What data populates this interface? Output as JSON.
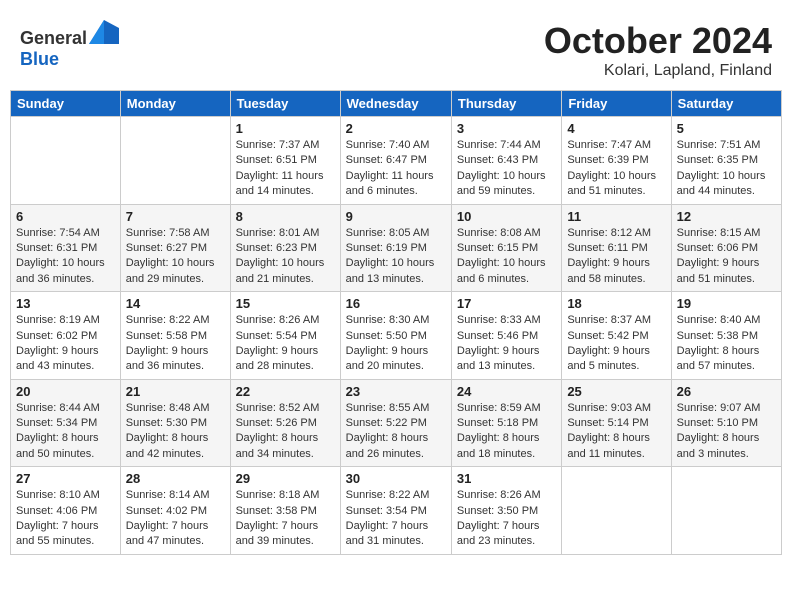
{
  "header": {
    "logo_general": "General",
    "logo_blue": "Blue",
    "month": "October 2024",
    "location": "Kolari, Lapland, Finland"
  },
  "weekdays": [
    "Sunday",
    "Monday",
    "Tuesday",
    "Wednesday",
    "Thursday",
    "Friday",
    "Saturday"
  ],
  "weeks": [
    [
      {
        "day": "",
        "detail": ""
      },
      {
        "day": "",
        "detail": ""
      },
      {
        "day": "1",
        "detail": "Sunrise: 7:37 AM\nSunset: 6:51 PM\nDaylight: 11 hours\nand 14 minutes."
      },
      {
        "day": "2",
        "detail": "Sunrise: 7:40 AM\nSunset: 6:47 PM\nDaylight: 11 hours\nand 6 minutes."
      },
      {
        "day": "3",
        "detail": "Sunrise: 7:44 AM\nSunset: 6:43 PM\nDaylight: 10 hours\nand 59 minutes."
      },
      {
        "day": "4",
        "detail": "Sunrise: 7:47 AM\nSunset: 6:39 PM\nDaylight: 10 hours\nand 51 minutes."
      },
      {
        "day": "5",
        "detail": "Sunrise: 7:51 AM\nSunset: 6:35 PM\nDaylight: 10 hours\nand 44 minutes."
      }
    ],
    [
      {
        "day": "6",
        "detail": "Sunrise: 7:54 AM\nSunset: 6:31 PM\nDaylight: 10 hours\nand 36 minutes."
      },
      {
        "day": "7",
        "detail": "Sunrise: 7:58 AM\nSunset: 6:27 PM\nDaylight: 10 hours\nand 29 minutes."
      },
      {
        "day": "8",
        "detail": "Sunrise: 8:01 AM\nSunset: 6:23 PM\nDaylight: 10 hours\nand 21 minutes."
      },
      {
        "day": "9",
        "detail": "Sunrise: 8:05 AM\nSunset: 6:19 PM\nDaylight: 10 hours\nand 13 minutes."
      },
      {
        "day": "10",
        "detail": "Sunrise: 8:08 AM\nSunset: 6:15 PM\nDaylight: 10 hours\nand 6 minutes."
      },
      {
        "day": "11",
        "detail": "Sunrise: 8:12 AM\nSunset: 6:11 PM\nDaylight: 9 hours\nand 58 minutes."
      },
      {
        "day": "12",
        "detail": "Sunrise: 8:15 AM\nSunset: 6:06 PM\nDaylight: 9 hours\nand 51 minutes."
      }
    ],
    [
      {
        "day": "13",
        "detail": "Sunrise: 8:19 AM\nSunset: 6:02 PM\nDaylight: 9 hours\nand 43 minutes."
      },
      {
        "day": "14",
        "detail": "Sunrise: 8:22 AM\nSunset: 5:58 PM\nDaylight: 9 hours\nand 36 minutes."
      },
      {
        "day": "15",
        "detail": "Sunrise: 8:26 AM\nSunset: 5:54 PM\nDaylight: 9 hours\nand 28 minutes."
      },
      {
        "day": "16",
        "detail": "Sunrise: 8:30 AM\nSunset: 5:50 PM\nDaylight: 9 hours\nand 20 minutes."
      },
      {
        "day": "17",
        "detail": "Sunrise: 8:33 AM\nSunset: 5:46 PM\nDaylight: 9 hours\nand 13 minutes."
      },
      {
        "day": "18",
        "detail": "Sunrise: 8:37 AM\nSunset: 5:42 PM\nDaylight: 9 hours\nand 5 minutes."
      },
      {
        "day": "19",
        "detail": "Sunrise: 8:40 AM\nSunset: 5:38 PM\nDaylight: 8 hours\nand 57 minutes."
      }
    ],
    [
      {
        "day": "20",
        "detail": "Sunrise: 8:44 AM\nSunset: 5:34 PM\nDaylight: 8 hours\nand 50 minutes."
      },
      {
        "day": "21",
        "detail": "Sunrise: 8:48 AM\nSunset: 5:30 PM\nDaylight: 8 hours\nand 42 minutes."
      },
      {
        "day": "22",
        "detail": "Sunrise: 8:52 AM\nSunset: 5:26 PM\nDaylight: 8 hours\nand 34 minutes."
      },
      {
        "day": "23",
        "detail": "Sunrise: 8:55 AM\nSunset: 5:22 PM\nDaylight: 8 hours\nand 26 minutes."
      },
      {
        "day": "24",
        "detail": "Sunrise: 8:59 AM\nSunset: 5:18 PM\nDaylight: 8 hours\nand 18 minutes."
      },
      {
        "day": "25",
        "detail": "Sunrise: 9:03 AM\nSunset: 5:14 PM\nDaylight: 8 hours\nand 11 minutes."
      },
      {
        "day": "26",
        "detail": "Sunrise: 9:07 AM\nSunset: 5:10 PM\nDaylight: 8 hours\nand 3 minutes."
      }
    ],
    [
      {
        "day": "27",
        "detail": "Sunrise: 8:10 AM\nSunset: 4:06 PM\nDaylight: 7 hours\nand 55 minutes."
      },
      {
        "day": "28",
        "detail": "Sunrise: 8:14 AM\nSunset: 4:02 PM\nDaylight: 7 hours\nand 47 minutes."
      },
      {
        "day": "29",
        "detail": "Sunrise: 8:18 AM\nSunset: 3:58 PM\nDaylight: 7 hours\nand 39 minutes."
      },
      {
        "day": "30",
        "detail": "Sunrise: 8:22 AM\nSunset: 3:54 PM\nDaylight: 7 hours\nand 31 minutes."
      },
      {
        "day": "31",
        "detail": "Sunrise: 8:26 AM\nSunset: 3:50 PM\nDaylight: 7 hours\nand 23 minutes."
      },
      {
        "day": "",
        "detail": ""
      },
      {
        "day": "",
        "detail": ""
      }
    ]
  ]
}
